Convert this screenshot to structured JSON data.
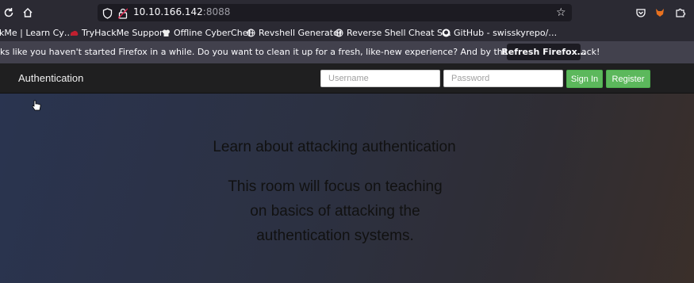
{
  "browser": {
    "url_host": "10.10.166.142",
    "url_port": ":8088",
    "bookmarks": [
      {
        "label": "kMe | Learn Cy…",
        "icon": "none"
      },
      {
        "label": "TryHackMe Support",
        "icon": "tryhackme-icon"
      },
      {
        "label": "Offline CyberChef",
        "icon": "chef-icon"
      },
      {
        "label": "Revshell Generator",
        "icon": "globe-icon"
      },
      {
        "label": "Reverse Shell Cheat S…",
        "icon": "globe-icon"
      },
      {
        "label": "GitHub - swisskyrepo/…",
        "icon": "github-icon"
      }
    ],
    "notification": {
      "text": "ks like you haven't started Firefox in a while. Do you want to clean it up for a fresh, like-new experience? And by the way, welcome back!",
      "button": "Refresh Firefox…"
    }
  },
  "navbar": {
    "brand": "Authentication",
    "username_placeholder": "Username",
    "password_placeholder": "Password",
    "signin_label": "Sign In",
    "register_label": "Register"
  },
  "main": {
    "title": "Learn about attacking authentication",
    "lead_lines": [
      "This room will focus on teaching",
      "on basics of attacking the",
      "authentication systems."
    ]
  },
  "colors": {
    "button_green": "#5cb85c",
    "navbar_bg": "#1f1f20"
  }
}
